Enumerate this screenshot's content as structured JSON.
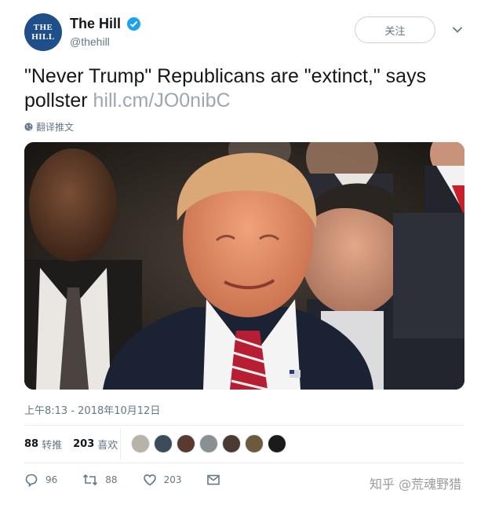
{
  "header": {
    "avatar_line1": "THE",
    "avatar_line2": "HILL",
    "display_name": "The Hill",
    "handle": "@thehill",
    "follow_label": "关注"
  },
  "tweet": {
    "text": "\"Never Trump\" Republicans are \"extinct,\" says pollster ",
    "link": "hill.cm/JO0nibC",
    "translate_label": "翻译推文",
    "timestamp": "上午8:13 - 2018年10月12日"
  },
  "stats": {
    "retweets_count": "88",
    "retweets_label": "转推",
    "likes_count": "203",
    "likes_label": "喜欢"
  },
  "likers": [
    {
      "icon": "liker-avatar-1",
      "color": "#b9b2a6"
    },
    {
      "icon": "liker-avatar-2",
      "color": "#3c4b5a"
    },
    {
      "icon": "liker-avatar-3",
      "color": "#5a3a2e"
    },
    {
      "icon": "liker-avatar-4",
      "color": "#8a8f92"
    },
    {
      "icon": "liker-avatar-5",
      "color": "#4a3a30"
    },
    {
      "icon": "liker-avatar-6",
      "color": "#6b5a3c"
    },
    {
      "icon": "liker-avatar-7",
      "color": "#1b1b1b"
    }
  ],
  "actions": {
    "reply_count": "96",
    "retweet_count": "88",
    "like_count": "203"
  },
  "watermark": "知乎 @荒魂野猎",
  "colors": {
    "accent": "#1da1f2",
    "avatar_bg": "#1f4f8a",
    "muted": "#657786"
  }
}
